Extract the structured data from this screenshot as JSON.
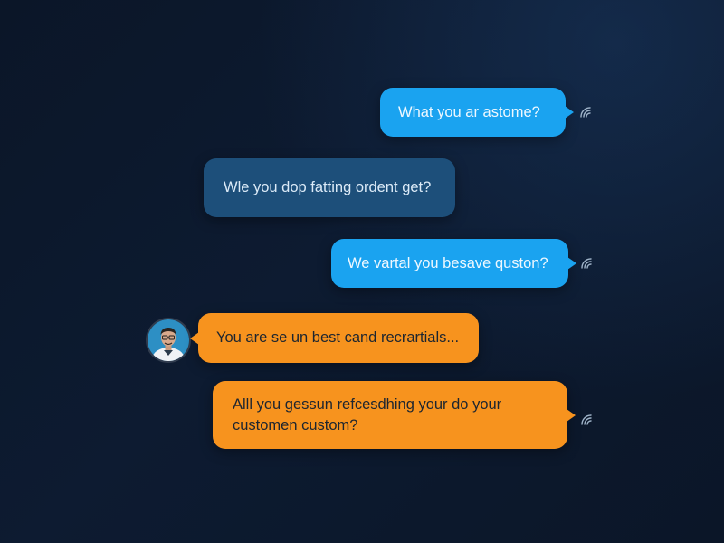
{
  "colors": {
    "background": "#0b1628",
    "outgoing_bubble": "#1aa3f0",
    "incoming_bubble_blue": "#1d4f7a",
    "incoming_bubble_orange": "#f7931e"
  },
  "messages": [
    {
      "text": "What you ar astome?",
      "direction": "outgoing",
      "status_icon": "read-receipt-icon"
    },
    {
      "text": "Wle you dop fatting ordent get?",
      "direction": "incoming"
    },
    {
      "text": "We vartal you besave quston?",
      "direction": "outgoing",
      "status_icon": "read-receipt-icon"
    },
    {
      "text": "You are se un best cand recrartials...",
      "direction": "incoming",
      "avatar_icon": "user-avatar"
    },
    {
      "text": "Alll you gessun refcesdhing your do your customen custom?",
      "direction": "outgoing",
      "status_icon": "read-receipt-icon"
    }
  ]
}
